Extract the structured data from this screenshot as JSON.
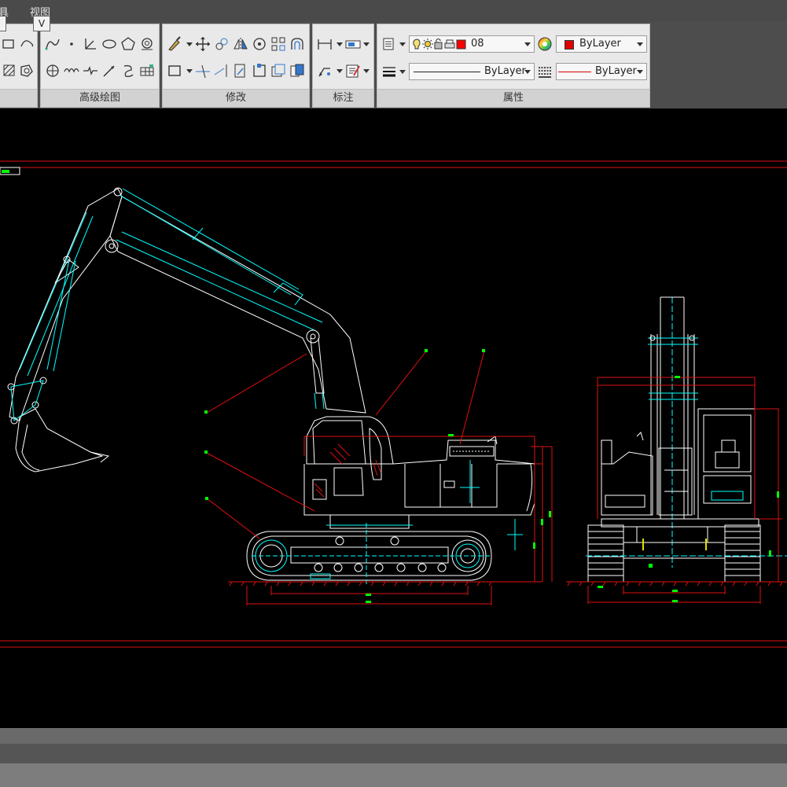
{
  "menu": {
    "item1": "具",
    "item2": "视图"
  },
  "keytip": "V",
  "panels": {
    "advanced_draw": "高级绘图",
    "modify": "修改",
    "annotate": "标注",
    "properties": "属性"
  },
  "properties": {
    "layer": "08",
    "color": "ByLayer",
    "linetype": "ByLayer",
    "lineweight": "ByLayer"
  },
  "colors": {
    "canvas": "#000000",
    "drawing_white": "#ffffff",
    "drawing_cyan": "#00ffff",
    "drawing_red": "#ff0000",
    "drawing_green": "#00ff00",
    "layer_red": "#ff0000"
  }
}
